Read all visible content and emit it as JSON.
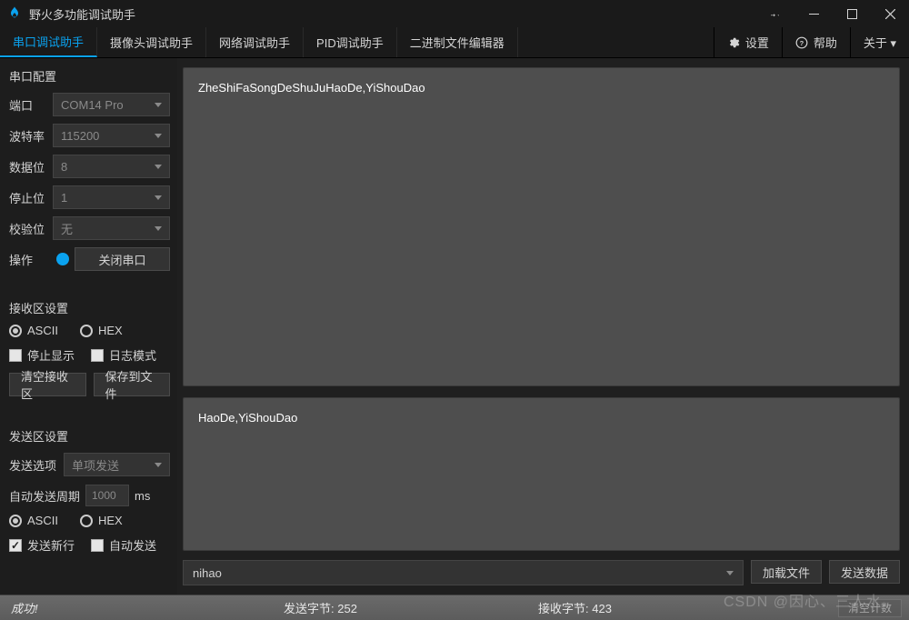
{
  "app": {
    "title": "野火多功能调试助手"
  },
  "tabs": [
    {
      "label": "串口调试助手",
      "active": true
    },
    {
      "label": "摄像头调试助手",
      "active": false
    },
    {
      "label": "网络调试助手",
      "active": false
    },
    {
      "label": "PID调试助手",
      "active": false
    },
    {
      "label": "二进制文件编辑器",
      "active": false
    }
  ],
  "toolbar": {
    "settings": "设置",
    "help": "帮助",
    "about": "关于 ▾"
  },
  "serial_cfg": {
    "title": "串口配置",
    "port_label": "端口",
    "port_value": "COM14 Pro",
    "baud_label": "波特率",
    "baud_value": "115200",
    "data_label": "数据位",
    "data_value": "8",
    "stop_label": "停止位",
    "stop_value": "1",
    "parity_label": "校验位",
    "parity_value": "无",
    "op_label": "操作",
    "close_btn": "关闭串口"
  },
  "recv_cfg": {
    "title": "接收区设置",
    "ascii": "ASCII",
    "hex": "HEX",
    "mode": "ascii",
    "stop_label": "停止显示",
    "stop_checked": false,
    "log_label": "日志模式",
    "log_checked": false,
    "clear_btn": "清空接收区",
    "save_btn": "保存到文件"
  },
  "send_cfg": {
    "title": "发送区设置",
    "mode_label": "发送选项",
    "mode_value": "单项发送",
    "period_label": "自动发送周期",
    "period_value": "1000",
    "period_unit": "ms",
    "ascii": "ASCII",
    "hex": "HEX",
    "fmt": "ascii",
    "newline_label": "发送新行",
    "newline_checked": true,
    "auto_label": "自动发送",
    "auto_checked": false
  },
  "recv_text": "ZheShiFaSongDeShuJuHaoDe,YiShouDao",
  "send_text": "HaoDe,YiShouDao",
  "send_row": {
    "history_value": "nihao",
    "load_btn": "加载文件",
    "send_btn": "发送数据"
  },
  "status": {
    "ok": "成功!",
    "tx_label": "发送字节:",
    "tx_value": "252",
    "rx_label": "接收字节:",
    "rx_value": "423",
    "clear_btn": "清空计数",
    "watermark": "CSDN @因心、三人水"
  }
}
